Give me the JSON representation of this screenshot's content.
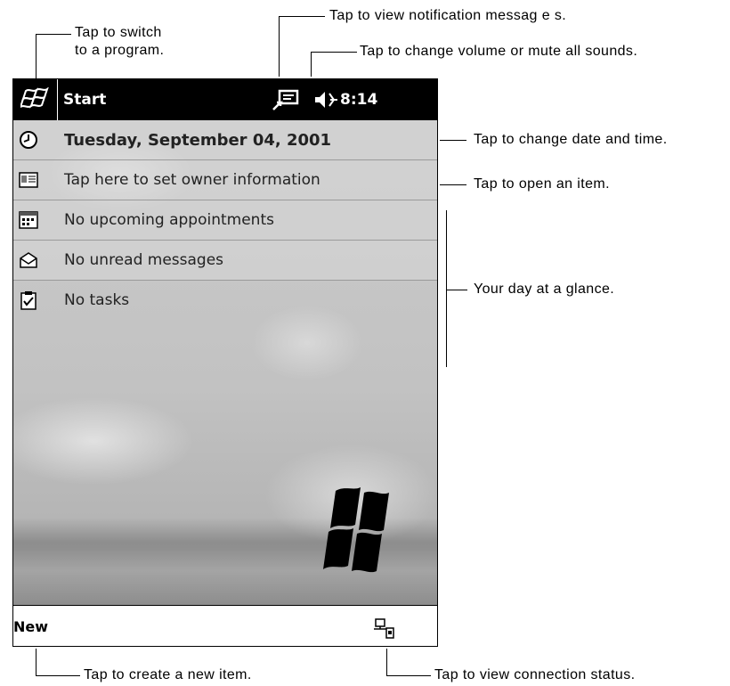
{
  "titlebar": {
    "start_label": "Start",
    "time": "8:14"
  },
  "today": {
    "items": [
      {
        "label": "Tuesday, September 04, 2001",
        "icon": "clock-icon"
      },
      {
        "label": "Tap here to set owner information",
        "icon": "owner-card-icon"
      },
      {
        "label": "No upcoming appointments",
        "icon": "calendar-icon"
      },
      {
        "label": "No unread messages",
        "icon": "envelope-icon"
      },
      {
        "label": "No tasks",
        "icon": "task-clipboard-icon"
      }
    ]
  },
  "menubar": {
    "new_label": "New"
  },
  "annotations": {
    "switch_program": [
      "Tap to switch",
      "to a program."
    ],
    "notifications": "Tap to view notification messag e s.",
    "volume": "Tap to change volume or mute all sounds.",
    "date_time": "Tap to change date and time.",
    "open_item": "Tap to open an item.",
    "day_glance": "Your day at a glance.",
    "new_item": "Tap to create a new item.",
    "connection": "Tap to view connection status."
  },
  "colors": {
    "titlebar_bg": "#000000",
    "screen_bg": "#cfcfcf",
    "text": "#000000"
  }
}
